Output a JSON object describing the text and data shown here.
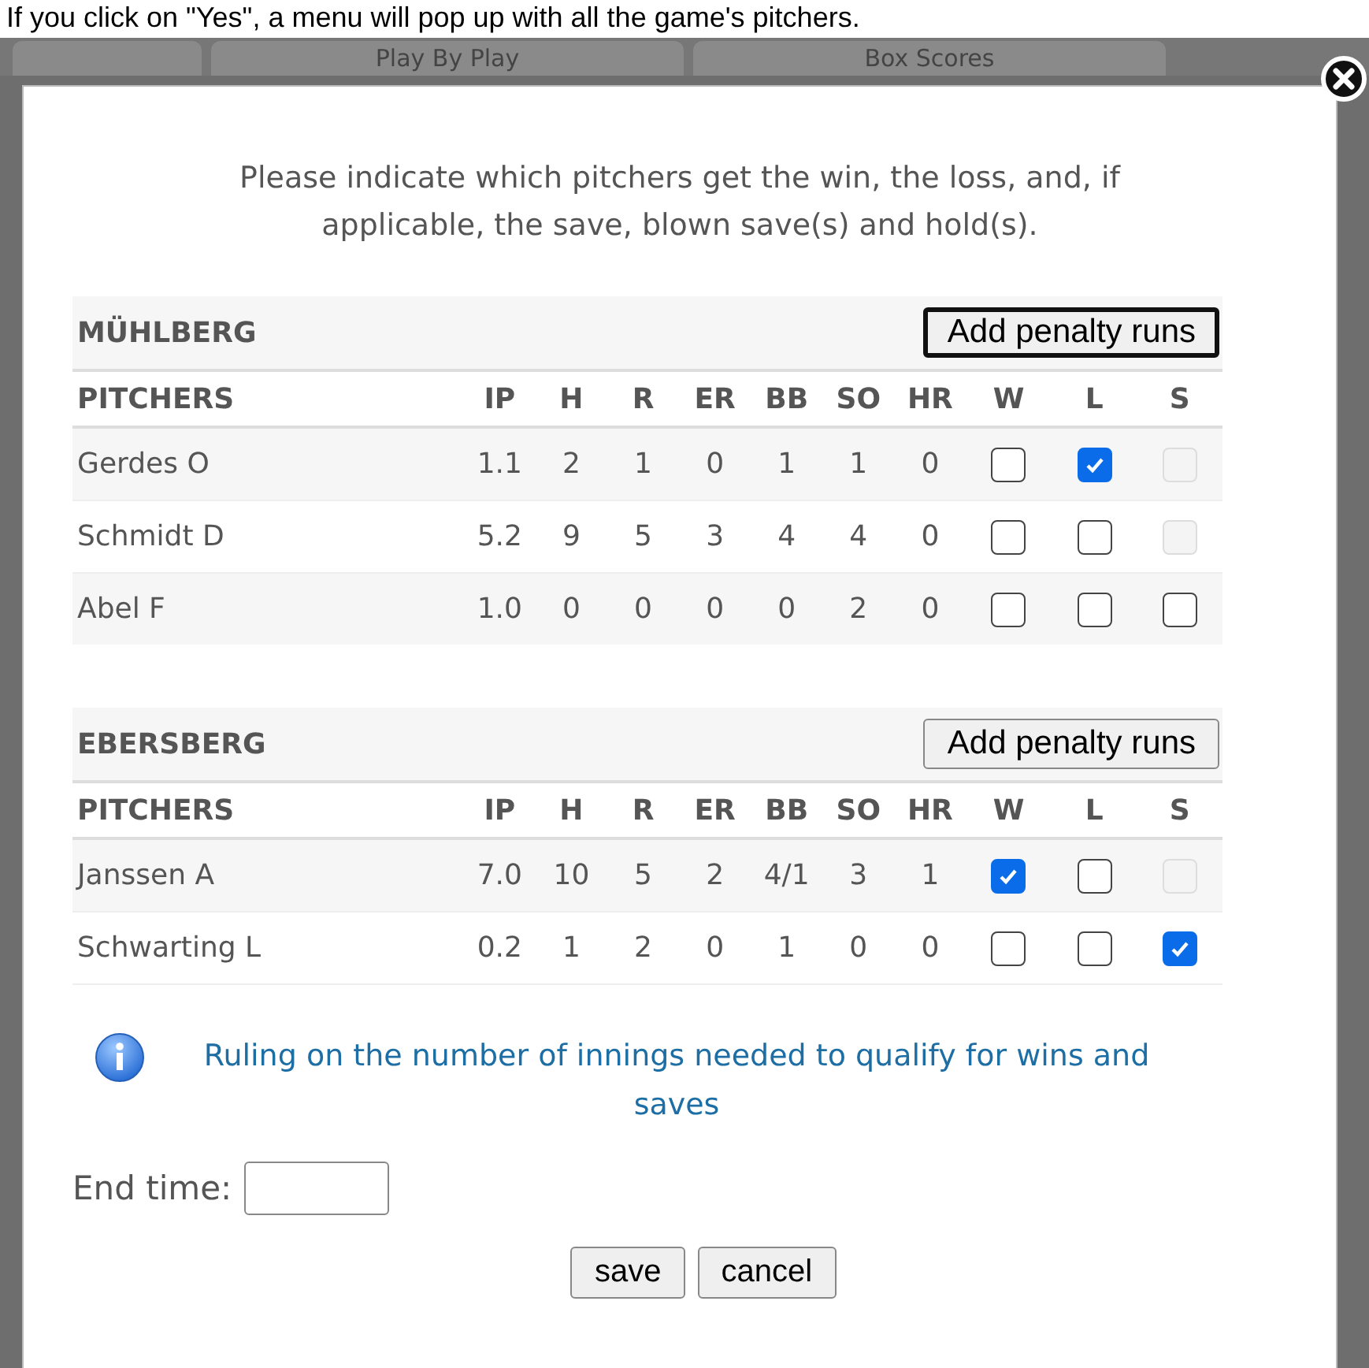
{
  "caption": "If you click on \"Yes\", a menu will pop up with all the game's pitchers.",
  "background_tabs": [
    {
      "label": "Play By Play"
    },
    {
      "label": "Box Scores"
    }
  ],
  "dialog": {
    "instructions": "Please indicate which pitchers get the win, the loss, and, if applicable, the save, blown save(s) and hold(s).",
    "teams": [
      {
        "name": "MÜHLBERG",
        "button": "Add penalty runs",
        "button_focused": true,
        "columns": [
          "PITCHERS",
          "IP",
          "H",
          "R",
          "ER",
          "BB",
          "SO",
          "HR",
          "W",
          "L",
          "S"
        ],
        "pitchers": [
          {
            "name": "Gerdes O",
            "stats": [
              "1.1",
              "2",
              "1",
              "0",
              "1",
              "1",
              "0"
            ],
            "decisions": [
              {
                "checked": false,
                "disabled": false
              },
              {
                "checked": true,
                "disabled": false
              },
              {
                "checked": false,
                "disabled": true
              }
            ]
          },
          {
            "name": "Schmidt D",
            "stats": [
              "5.2",
              "9",
              "5",
              "3",
              "4",
              "4",
              "0"
            ],
            "decisions": [
              {
                "checked": false,
                "disabled": false
              },
              {
                "checked": false,
                "disabled": false
              },
              {
                "checked": false,
                "disabled": true
              }
            ]
          },
          {
            "name": "Abel F",
            "stats": [
              "1.0",
              "0",
              "0",
              "0",
              "0",
              "2",
              "0"
            ],
            "decisions": [
              {
                "checked": false,
                "disabled": false
              },
              {
                "checked": false,
                "disabled": false
              },
              {
                "checked": false,
                "disabled": false
              }
            ]
          }
        ]
      },
      {
        "name": "EBERSBERG",
        "button": "Add penalty runs",
        "button_focused": false,
        "columns": [
          "PITCHERS",
          "IP",
          "H",
          "R",
          "ER",
          "BB",
          "SO",
          "HR",
          "W",
          "L",
          "S"
        ],
        "pitchers": [
          {
            "name": "Janssen A",
            "stats": [
              "7.0",
              "10",
              "5",
              "2",
              "4/1",
              "3",
              "1"
            ],
            "decisions": [
              {
                "checked": true,
                "disabled": false
              },
              {
                "checked": false,
                "disabled": false
              },
              {
                "checked": false,
                "disabled": true
              }
            ]
          },
          {
            "name": "Schwarting L",
            "stats": [
              "0.2",
              "1",
              "2",
              "0",
              "1",
              "0",
              "0"
            ],
            "decisions": [
              {
                "checked": false,
                "disabled": false
              },
              {
                "checked": false,
                "disabled": false
              },
              {
                "checked": true,
                "disabled": false
              }
            ]
          }
        ]
      }
    ],
    "ruling_link": "Ruling on the number of innings needed to qualify for wins and saves",
    "end_time": {
      "label": "End time:"
    },
    "buttons": [
      "save",
      "cancel"
    ]
  }
}
